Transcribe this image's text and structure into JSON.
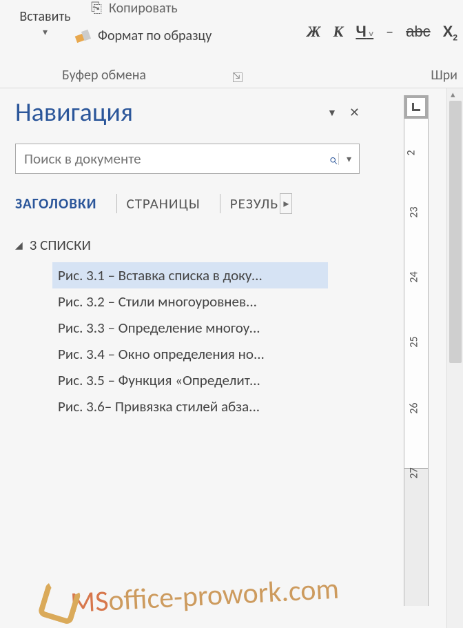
{
  "ribbon": {
    "paste_label": "Вставить",
    "copy_label": "Копировать",
    "format_painter_label": "Формат по образцу",
    "group_clipboard": "Буфер обмена",
    "group_font": "Шри",
    "bold": "Ж",
    "italic": "К",
    "underline": "Ч",
    "strike": "abc",
    "subscript": "X"
  },
  "nav": {
    "title": "Навигация",
    "search_placeholder": "Поиск в документе",
    "tabs": {
      "headings": "ЗАГОЛОВКИ",
      "pages": "СТРАНИЦЫ",
      "results": "РЕЗУЛЬ"
    },
    "root": "3  СПИСКИ",
    "items": [
      "Рис. 3.1 – Вставка списка в доку...",
      "Рис. 3.2 – Стили многоуровнев...",
      "Рис. 3.3 – Определение многоу...",
      "Рис. 3.4 – Окно определения но...",
      "Рис. 3.5 – Функция «Определит...",
      "Рис. 3.6– Привязка стилей абза..."
    ]
  },
  "ruler": {
    "ticks": [
      "2",
      "23",
      "24",
      "25",
      "26",
      "27"
    ]
  },
  "watermark": {
    "part1": "MS",
    "part2": "office-prowork.com"
  }
}
